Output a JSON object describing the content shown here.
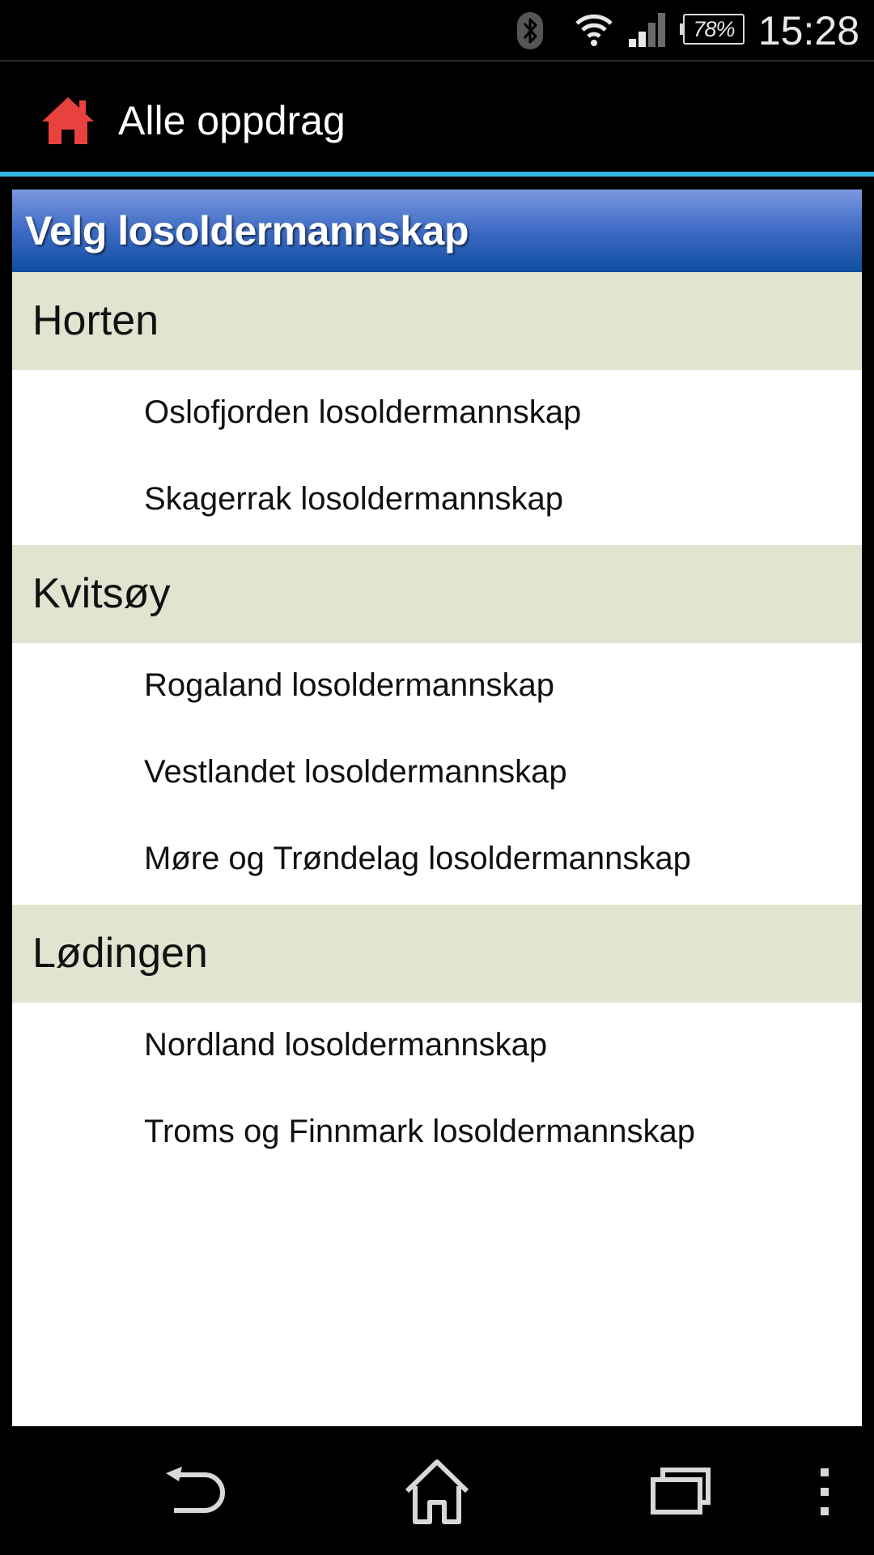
{
  "status_bar": {
    "icons": [
      "bluetooth-icon",
      "wifi-icon",
      "signal-icon",
      "battery-icon"
    ],
    "battery": "78%",
    "time": "15:28"
  },
  "action_bar": {
    "icon": "home-icon",
    "icon_color": "#e8423f",
    "title": "Alle oppdrag"
  },
  "accent_color": "#33b5e5",
  "panel": {
    "title": "Velg losoldermannskap",
    "groups": [
      {
        "label": "Horten",
        "items": [
          "Oslofjorden losoldermannskap",
          "Skagerrak losoldermannskap"
        ]
      },
      {
        "label": "Kvitsøy",
        "items": [
          "Rogaland losoldermannskap",
          "Vestlandet losoldermannskap",
          "Møre og Trøndelag losoldermannskap"
        ]
      },
      {
        "label": "Lødingen",
        "items": [
          "Nordland losoldermannskap",
          "Troms og Finnmark losoldermannskap"
        ]
      }
    ]
  },
  "nav_bar": {
    "buttons": [
      "back-icon",
      "home-icon",
      "recent-apps-icon",
      "overflow-menu-icon"
    ]
  }
}
